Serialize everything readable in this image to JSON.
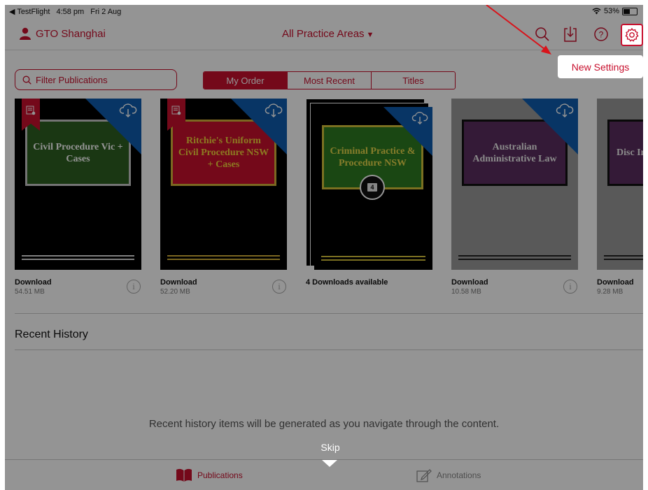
{
  "status_bar": {
    "back_app": "◀ TestFlight",
    "time": "4:58 pm",
    "date": "Fri 2 Aug",
    "battery": "53%",
    "battery_level": 0.53
  },
  "nav": {
    "user_name": "GTO Shanghai",
    "practice_area": "All Practice Areas"
  },
  "filter": {
    "placeholder": "Filter Publications"
  },
  "sort_tabs": [
    "My Order",
    "Most Recent",
    "Titles"
  ],
  "tooltip": "New Settings",
  "books": [
    {
      "title": "Civil Procedure Vic + Cases",
      "status": "Download",
      "size": "54.51 MB"
    },
    {
      "title": "Ritchie's Uniform Civil Procedure NSW + Cases",
      "status": "Download",
      "size": "52.20 MB"
    },
    {
      "title": "Criminal Practice & Procedure NSW",
      "status": "4 Downloads available",
      "badge": "4"
    },
    {
      "title": "Australian Administrative Law",
      "status": "Download",
      "size": "10.58 MB"
    },
    {
      "title": "Disc Interroga",
      "status": "Download",
      "size": "9.28 MB"
    }
  ],
  "recent_history": {
    "title": "Recent History",
    "empty_message": "Recent history items will be generated as you navigate through the content."
  },
  "skip_label": "Skip",
  "tab_bar": {
    "publications": "Publications",
    "annotations": "Annotations"
  },
  "colors": {
    "accent": "#c8102e",
    "corner_blue": "#0f5cae"
  }
}
